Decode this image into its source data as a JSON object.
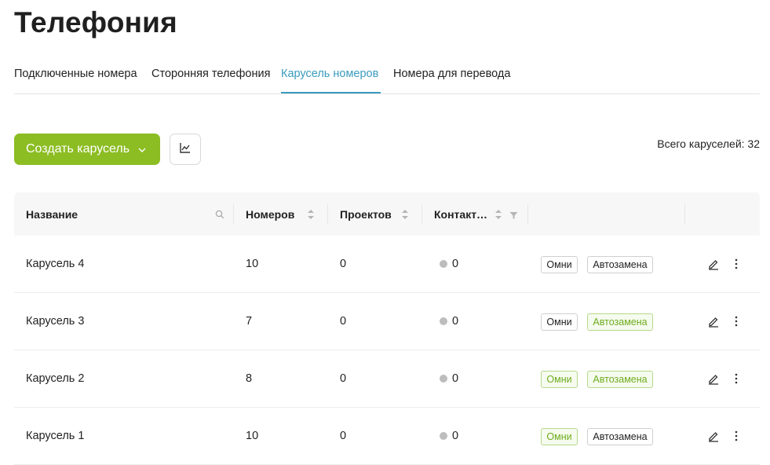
{
  "page": {
    "title": "Телефония"
  },
  "tabs": [
    {
      "label": "Подключенные номера",
      "active": false
    },
    {
      "label": "Сторонняя телефония",
      "active": false
    },
    {
      "label": "Карусель номеров",
      "active": true
    },
    {
      "label": "Номера для перевода",
      "active": false
    }
  ],
  "toolbar": {
    "create_label": "Создать карусель",
    "create_icon": "chevron-down-icon",
    "stats_icon": "line-chart-icon",
    "total_text": "Всего каруселей: 32"
  },
  "table": {
    "columns": [
      {
        "label": "Название",
        "icon": "search-icon"
      },
      {
        "label": "Номеров",
        "icon": "sort-icon"
      },
      {
        "label": "Проектов",
        "icon": "sort-icon"
      },
      {
        "label": "Контакт…",
        "icon": "sort-icon"
      },
      {
        "label": "",
        "icon": ""
      },
      {
        "label": "",
        "icon": ""
      }
    ],
    "rows": [
      {
        "name": "Карусель 4",
        "numbers": "10",
        "projects": "0",
        "contacts": "0",
        "tag_omni": "Омни",
        "omni_on": false,
        "tag_auto": "Автозамена",
        "auto_on": false
      },
      {
        "name": "Карусель 3",
        "numbers": "7",
        "projects": "0",
        "contacts": "0",
        "tag_omni": "Омни",
        "omni_on": false,
        "tag_auto": "Автозамена",
        "auto_on": true
      },
      {
        "name": "Карусель 2",
        "numbers": "8",
        "projects": "0",
        "contacts": "0",
        "tag_omni": "Омни",
        "omni_on": true,
        "tag_auto": "Автозамена",
        "auto_on": true
      },
      {
        "name": "Карусель 1",
        "numbers": "10",
        "projects": "0",
        "contacts": "0",
        "tag_omni": "Омни",
        "omni_on": true,
        "tag_auto": "Автозамена",
        "auto_on": false
      }
    ]
  },
  "colors": {
    "accent": "#3a9bbd",
    "brand_green": "#8cbd23",
    "tag_active": "#6eac1e",
    "status_dot": "#bdbdbd"
  }
}
